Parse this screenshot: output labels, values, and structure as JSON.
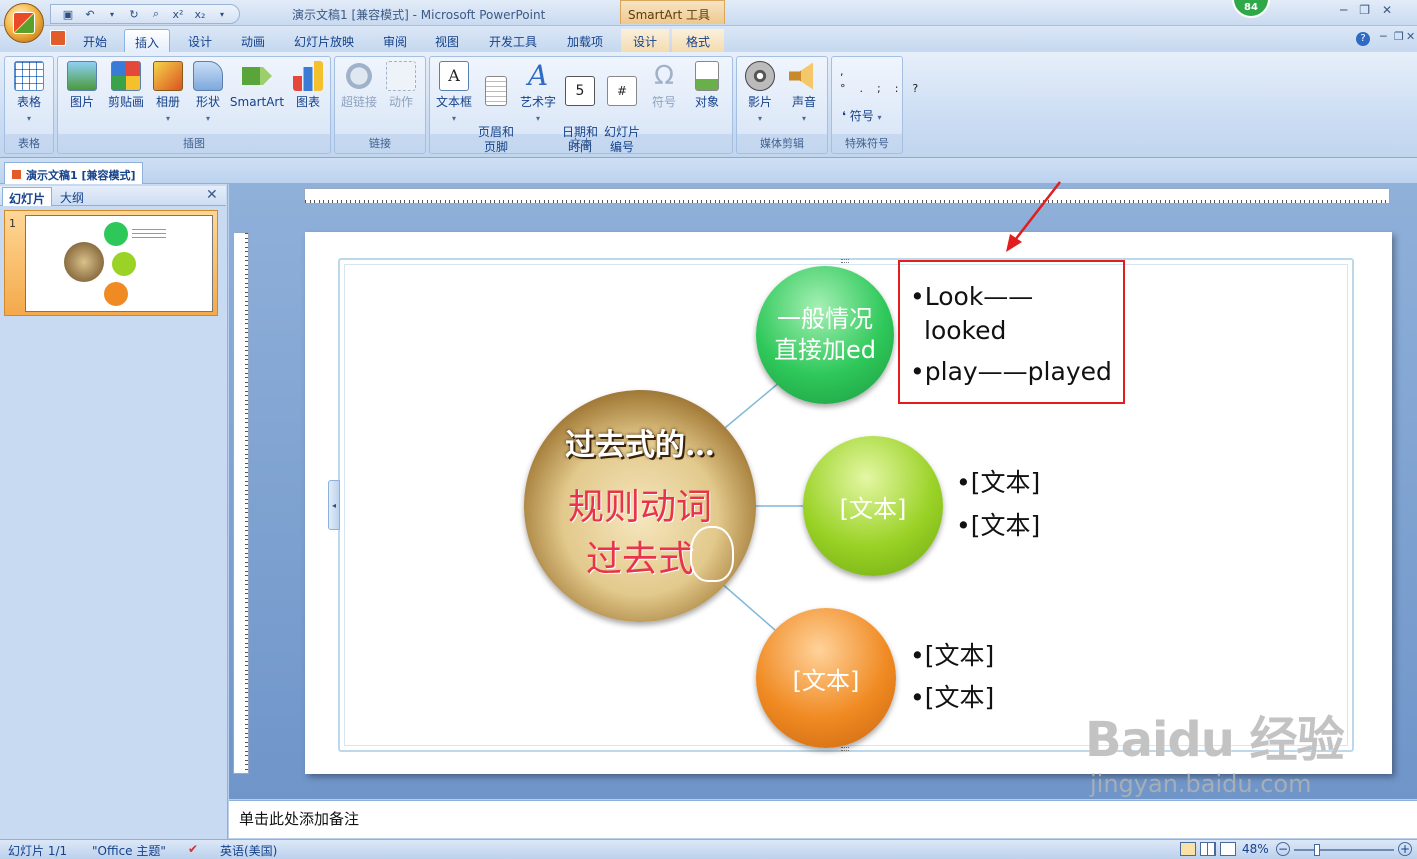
{
  "window": {
    "title": "演示文稿1 [兼容模式] - Microsoft PowerPoint",
    "context_tool": "SmartArt 工具",
    "badge": "84"
  },
  "tabs": [
    "开始",
    "插入",
    "设计",
    "动画",
    "幻灯片放映",
    "审阅",
    "视图",
    "开发工具",
    "加载项",
    "设计",
    "格式"
  ],
  "active_tab": "插入",
  "ribbon": {
    "groups": {
      "table": {
        "label": "表格",
        "buttons": [
          "表格"
        ]
      },
      "illustrations": {
        "label": "插图",
        "buttons": [
          "图片",
          "剪贴画",
          "相册",
          "形状",
          "SmartArt",
          "图表"
        ]
      },
      "links": {
        "label": "链接",
        "buttons": [
          "超链接",
          "动作"
        ]
      },
      "text": {
        "label": "文本",
        "buttons": [
          "文本框",
          "页眉和\n页脚",
          "艺术字",
          "日期和\n时间",
          "幻灯片\n编号",
          "符号",
          "对象"
        ]
      },
      "media": {
        "label": "媒体剪辑",
        "buttons": [
          "影片",
          "声音"
        ]
      },
      "special": {
        "label": "特殊符号",
        "symbol_label": "符号"
      }
    }
  },
  "document_tab": "演示文稿1 [兼容模式]",
  "left_pane": {
    "tabs": [
      "幻灯片",
      "大纲"
    ],
    "slide_number": "1"
  },
  "slide": {
    "center_circle": {
      "line1": "过去式的…",
      "line2": "规则动词",
      "line3": "过去式"
    },
    "nodes": [
      {
        "label": "一般情况直接加ed",
        "bullets": [
          "Look——",
          "looked",
          "play——played"
        ],
        "color": "#2ec85a"
      },
      {
        "label": "[文本]",
        "bullets": [
          "[文本]",
          "[文本]"
        ],
        "color": "#9ad226"
      },
      {
        "label": "[文本]",
        "bullets": [
          "[文本]",
          "[文本]"
        ],
        "color": "#f08a22"
      }
    ]
  },
  "notes_placeholder": "单击此处添加备注",
  "status": {
    "slide": "幻灯片 1/1",
    "theme": "\"Office 主题\"",
    "language": "英语(美国)",
    "zoom": "48%"
  },
  "watermark": {
    "brand": "Baidu 经验",
    "url": "jingyan.baidu.com"
  }
}
